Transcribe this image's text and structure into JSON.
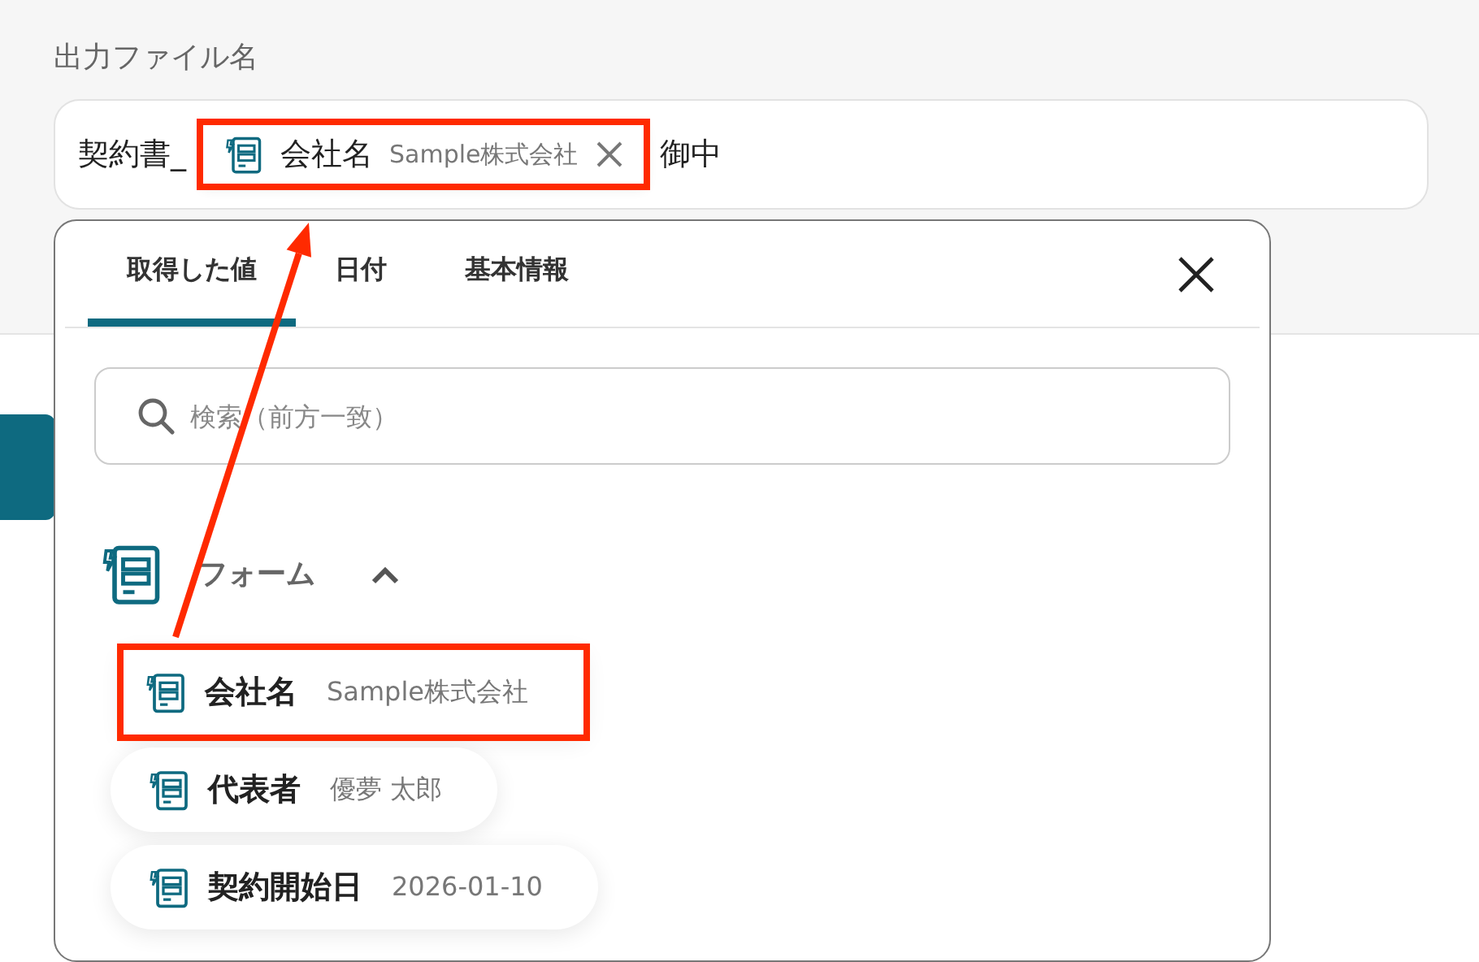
{
  "field": {
    "label": "出力ファイル名",
    "segments": [
      {
        "kind": "text",
        "text": "契約書_"
      },
      {
        "kind": "chip",
        "name": "会社名",
        "value": "Sample株式会社",
        "highlighted": true
      },
      {
        "kind": "text",
        "text": "御中"
      }
    ]
  },
  "picker": {
    "tabs": [
      {
        "label": "取得した値",
        "selected": true
      },
      {
        "label": "日付",
        "selected": false
      },
      {
        "label": "基本情報",
        "selected": false
      }
    ],
    "search": {
      "placeholder": "検索（前方一致）"
    },
    "groups": [
      {
        "title": "フォーム",
        "expanded": true,
        "items": [
          {
            "name": "会社名",
            "value": "Sample株式会社",
            "highlighted": true
          },
          {
            "name": "代表者",
            "value": "優夢 太郎",
            "highlighted": false
          },
          {
            "name": "契約開始日",
            "value": "2026-01-10",
            "highlighted": false
          }
        ]
      }
    ]
  }
}
